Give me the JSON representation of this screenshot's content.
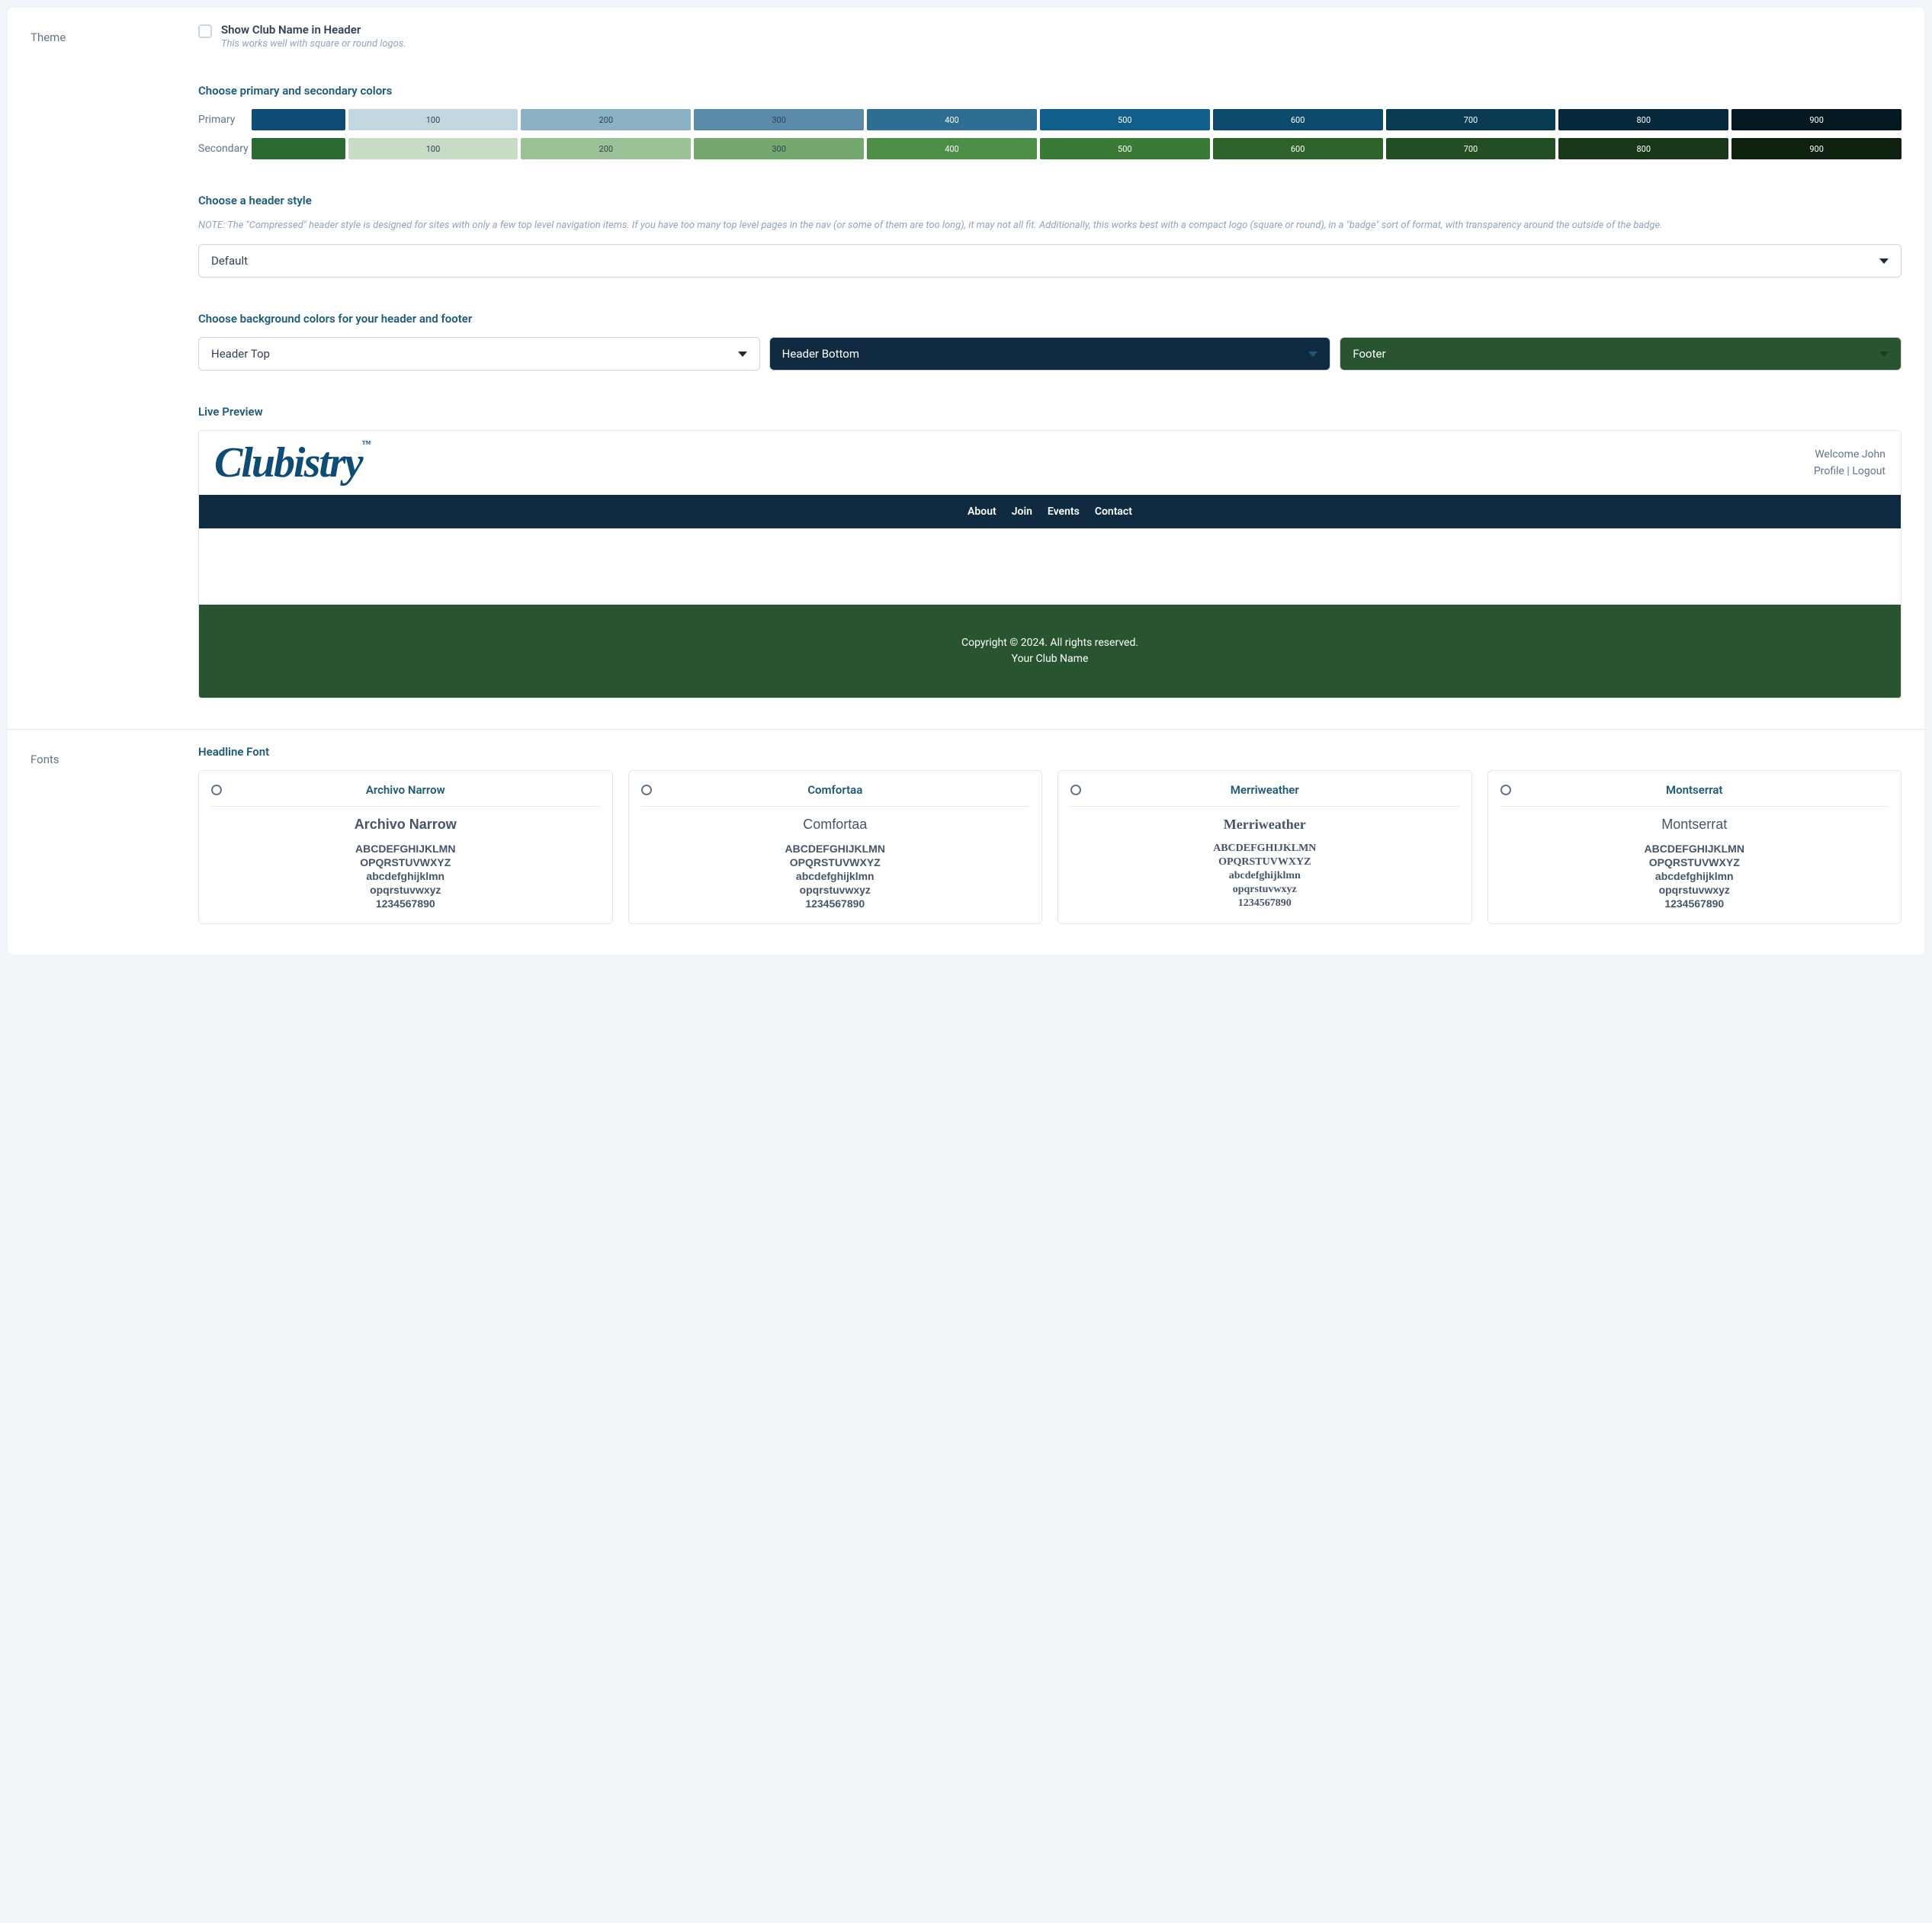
{
  "theme": {
    "section_label": "Theme",
    "show_club_name": {
      "label": "Show Club Name in Header",
      "help": "This works well with square or round logos."
    },
    "colors": {
      "heading": "Choose primary and secondary colors",
      "primary_label": "Primary",
      "secondary_label": "Secondary",
      "shades": [
        "100",
        "200",
        "300",
        "400",
        "500",
        "600",
        "700",
        "800",
        "900"
      ],
      "primary_base": "#0f4c75",
      "primary_swatches": [
        "#c3d7e1",
        "#8bb1c4",
        "#5b8ba8",
        "#2e6e93",
        "#115e8a",
        "#0c4b6e",
        "#0b3a55",
        "#07283a",
        "#041822"
      ],
      "secondary_base": "#2d6a33",
      "secondary_swatches": [
        "#c8dcc5",
        "#9cc197",
        "#74a86e",
        "#4f8e49",
        "#3a7a36",
        "#2d622b",
        "#234d22",
        "#183718",
        "#0e210e"
      ]
    },
    "header_style": {
      "heading": "Choose a header style",
      "note": "NOTE: The \"Compressed\" header style is designed for sites with only a few top level navigation items. If you have too many top level pages in the nav (or some of them are too long), it may not all fit. Additionally, this works best with a compact logo (square or round), in a \"badge\" sort of format, with transparency around the outside of the badge.",
      "value": "Default"
    },
    "bg_colors": {
      "heading": "Choose background colors for your header and footer",
      "header_top": "Header Top",
      "header_bottom": "Header Bottom",
      "footer": "Footer"
    },
    "preview": {
      "heading": "Live Preview",
      "logo_text": "Clubistry",
      "logo_tm": "™",
      "welcome": "Welcome John",
      "profile": "Profile",
      "sep": " | ",
      "logout": "Logout",
      "nav": [
        "About",
        "Join",
        "Events",
        "Contact"
      ],
      "footer_copyright": "Copyright © 2024. All rights reserved.",
      "footer_club": "Your Club Name"
    }
  },
  "fonts": {
    "section_label": "Fonts",
    "heading": "Headline Font",
    "sample_upper1": "ABCDEFGHIJKLMN",
    "sample_upper2": "OPQRSTUVWXYZ",
    "sample_lower1": "abcdefghijklmn",
    "sample_lower2": "opqrstuvwxyz",
    "sample_num": "1234567890",
    "options": [
      {
        "name": "Archivo Narrow",
        "class": "archivo"
      },
      {
        "name": "Comfortaa",
        "class": "comfortaa"
      },
      {
        "name": "Merriweather",
        "class": "merriweather"
      },
      {
        "name": "Montserrat",
        "class": "montserrat"
      }
    ]
  }
}
